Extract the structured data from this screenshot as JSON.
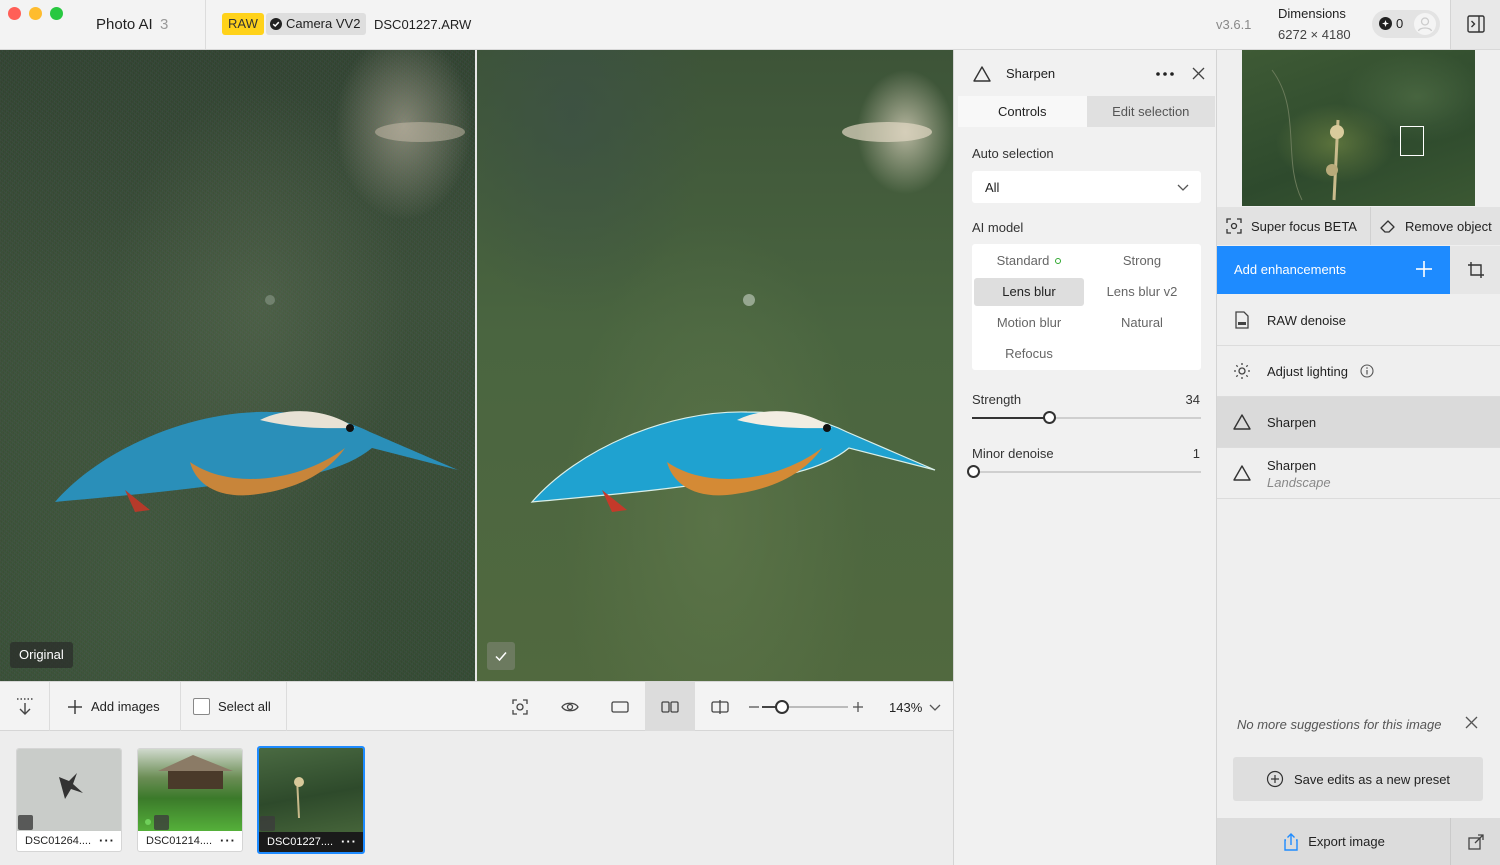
{
  "titlebar": {
    "app_name": "Photo AI",
    "image_count": "3",
    "raw_badge": "RAW",
    "camera_badge": "Camera VV2",
    "filename": "DSC01227.ARW",
    "version": "v3.6.1",
    "dimensions_label": "Dimensions",
    "dimensions_value": "6272 × 4180",
    "credits": "0"
  },
  "viewer": {
    "original_label": "Original"
  },
  "toolbar": {
    "add_images": "Add images",
    "select_all": "Select all",
    "zoom": "143%",
    "zoom_level": 0.23
  },
  "filmstrip": {
    "items": [
      {
        "name": "DSC01264....",
        "active": false
      },
      {
        "name": "DSC01214....",
        "active": false
      },
      {
        "name": "DSC01227....",
        "active": true
      }
    ]
  },
  "sharpen": {
    "title": "Sharpen",
    "tabs": [
      "Controls",
      "Edit selection"
    ],
    "auto_selection_label": "Auto selection",
    "auto_selection_value": "All",
    "ai_model_label": "AI model",
    "models": [
      "Standard",
      "Strong",
      "Lens blur",
      "Lens blur v2",
      "Motion blur",
      "Natural",
      "Refocus"
    ],
    "selected_model": "Lens blur",
    "strength_label": "Strength",
    "strength_value": "34",
    "minor_denoise_label": "Minor denoise",
    "minor_denoise_value": "1"
  },
  "right_panel": {
    "super_focus": "Super focus BETA",
    "remove_object": "Remove object",
    "add_enhancements": "Add enhancements",
    "enhancements": [
      {
        "label": "RAW denoise",
        "sub": ""
      },
      {
        "label": "Adjust lighting",
        "sub": ""
      },
      {
        "label": "Sharpen",
        "sub": ""
      },
      {
        "label": "Sharpen",
        "sub": "Landscape"
      }
    ],
    "no_more": "No more suggestions for this image",
    "save_preset": "Save edits as a new preset",
    "export": "Export image"
  },
  "colors": {
    "accent": "#1e8bff",
    "raw_badge": "#ffd21a"
  }
}
